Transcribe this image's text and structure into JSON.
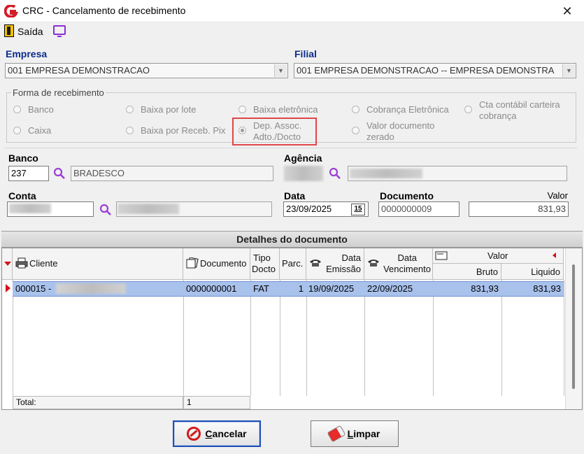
{
  "window": {
    "title": "CRC - Cancelamento de recebimento",
    "close_symbol": "✕"
  },
  "toolbar": {
    "exit_label": "Saída"
  },
  "empresa": {
    "label": "Empresa",
    "value": "001 EMPRESA DEMONSTRACAO"
  },
  "filial": {
    "label": "Filial",
    "value": "001 EMPRESA DEMONSTRACAO -- EMPRESA DEMONSTRA"
  },
  "forma": {
    "legend": "Forma de recebimento",
    "options": [
      {
        "label": "Banco"
      },
      {
        "label": "Baixa por lote"
      },
      {
        "label": "Baixa eletrônica"
      },
      {
        "label": "Cobrança Eletrônica"
      },
      {
        "label_line1": "Cta contábil carteira",
        "label_line2": "cobrança"
      },
      {
        "label": "Caixa"
      },
      {
        "label": "Baixa por Receb. Pix"
      },
      {
        "label_line1": "Dep. Assoc.",
        "label_line2": "Adto./Docto"
      },
      {
        "label_line1": "Valor documento",
        "label_line2": "zerado"
      }
    ],
    "selected": "Dep. Assoc. Adto./Docto"
  },
  "banco": {
    "label": "Banco",
    "code": "237",
    "name": "BRADESCO"
  },
  "agencia": {
    "label": "Agência"
  },
  "conta": {
    "label": "Conta"
  },
  "data": {
    "label": "Data",
    "value": "23/09/2025",
    "calendar_glyph": "15"
  },
  "documento": {
    "label": "Documento",
    "value": "0000000009"
  },
  "valor": {
    "label": "Valor",
    "value": "831,93"
  },
  "grid": {
    "title": "Detalhes do documento",
    "headers": {
      "cliente": "Cliente",
      "documento": "Documento",
      "tipo_line1": "Tipo",
      "tipo_line2": "Docto",
      "parc": "Parc.",
      "emissao_line1": "Data",
      "emissao_line2": "Emissão",
      "vencimento_line1": "Data",
      "vencimento_line2": "Vencimento",
      "valor": "Valor",
      "bruto": "Bruto",
      "liquido": "Liquido"
    },
    "rows": [
      {
        "cliente": "000015 -",
        "documento": "0000000001",
        "tipo": "FAT",
        "parc": "1",
        "emissao": "19/09/2025",
        "vencimento": "22/09/2025",
        "bruto": "831,93",
        "liquido": "831,93"
      }
    ],
    "footer": {
      "total_label": "Total:",
      "total_count": "1"
    }
  },
  "buttons": {
    "cancelar": {
      "accel": "C",
      "rest": "ancelar"
    },
    "limpar": {
      "accel": "L",
      "rest": "impar"
    }
  },
  "colors": {
    "label_blue": "#0b2c8a",
    "selection": "#a9c2ec",
    "highlight_red": "#e0454a",
    "accent_purple": "#8b2fd6"
  }
}
